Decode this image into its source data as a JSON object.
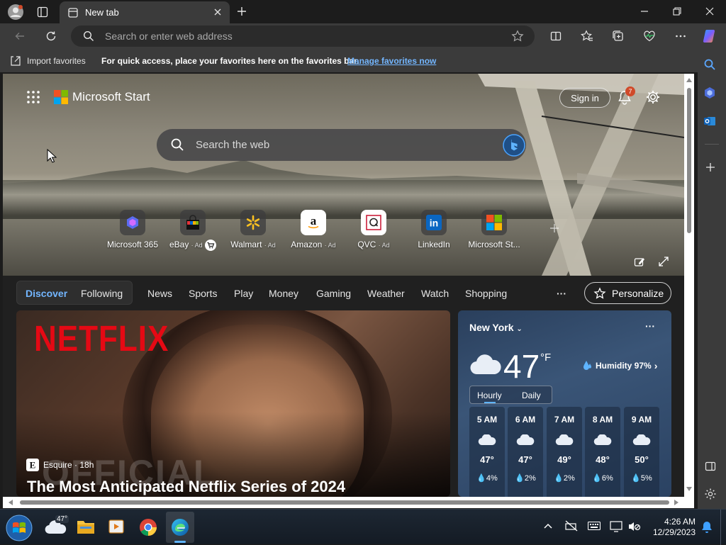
{
  "browser": {
    "tab_title": "New tab",
    "address_placeholder": "Search or enter web address"
  },
  "favorites_bar": {
    "import_label": "Import favorites",
    "message": "For quick access, place your favorites here on the favorites bar.",
    "manage_link": "Manage favorites now"
  },
  "start_page": {
    "brand": "Microsoft Start",
    "sign_in": "Sign in",
    "notification_count": "7",
    "search_placeholder": "Search the web",
    "quick_links": [
      {
        "label": "Microsoft 365",
        "ad": ""
      },
      {
        "label": "eBay",
        "ad": "· Ad"
      },
      {
        "label": "Walmart",
        "ad": "· Ad"
      },
      {
        "label": "Amazon",
        "ad": "· Ad"
      },
      {
        "label": "QVC",
        "ad": "· Ad"
      },
      {
        "label": "LinkedIn",
        "ad": ""
      },
      {
        "label": "Microsoft St...",
        "ad": ""
      }
    ]
  },
  "feed": {
    "segments": [
      "Discover",
      "Following"
    ],
    "tabs": [
      "News",
      "Sports",
      "Play",
      "Money",
      "Gaming",
      "Weather",
      "Watch",
      "Shopping"
    ],
    "more": "···",
    "personalize": "Personalize",
    "story": {
      "brand_logo": "NETFLIX",
      "watermark": "OFFICIAL",
      "source": "Esquire · 18h",
      "headline": "The Most Anticipated Netflix Series of 2024"
    }
  },
  "weather": {
    "city": "New York",
    "temperature": "47",
    "unit": "°F",
    "humidity": "Humidity 97%",
    "tabs": [
      "Hourly",
      "Daily"
    ],
    "hourly": [
      {
        "time": "5 AM",
        "temp": "47°",
        "precip": "4%"
      },
      {
        "time": "6 AM",
        "temp": "47°",
        "precip": "2%"
      },
      {
        "time": "7 AM",
        "temp": "49°",
        "precip": "2%"
      },
      {
        "time": "8 AM",
        "temp": "48°",
        "precip": "6%"
      },
      {
        "time": "9 AM",
        "temp": "50°",
        "precip": "5%"
      }
    ]
  },
  "taskbar": {
    "weather_badge": "47°",
    "time": "4:26 AM",
    "date": "12/29/2023"
  },
  "colors": {
    "accent": "#73b6ff",
    "netflix_red": "#e50914",
    "notification": "#d04a2a"
  }
}
